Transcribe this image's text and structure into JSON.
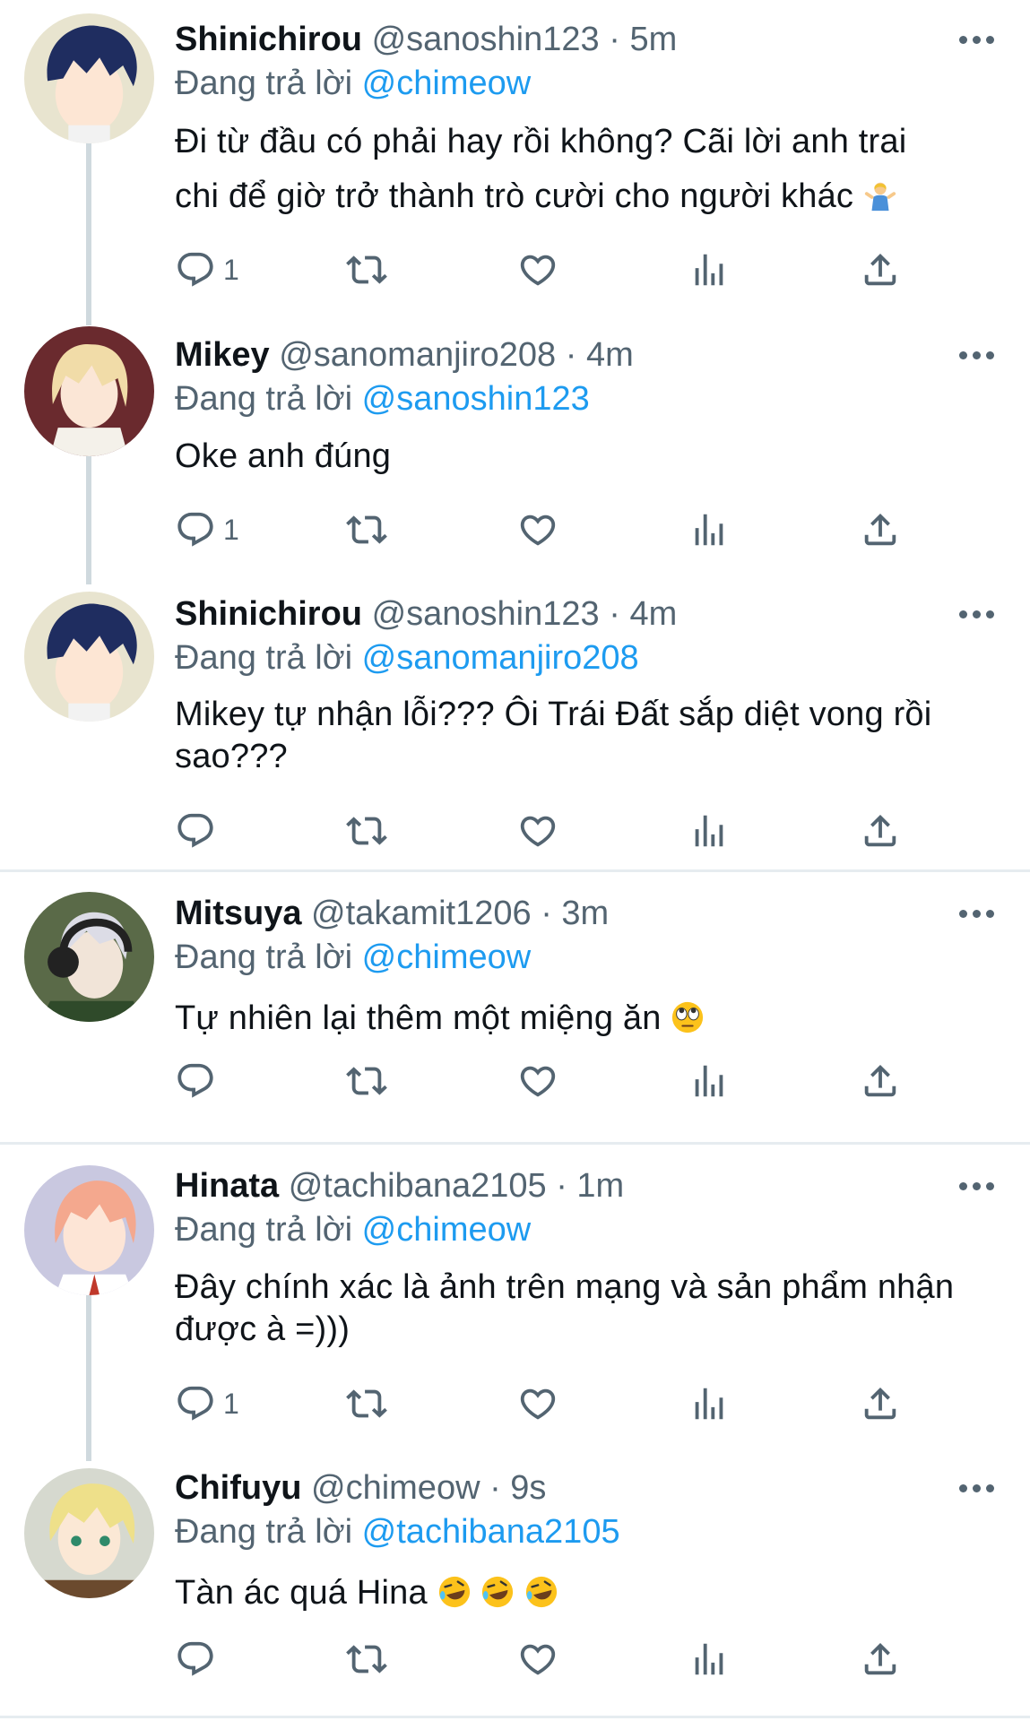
{
  "reply_prefix": "Đang trả lời",
  "colors": {
    "accent": "#1d9bf0",
    "text": "#0f1419",
    "muted": "#536471",
    "thread_line": "#cfd9de",
    "divider": "#e6ecf0"
  },
  "icons": [
    "reply-icon",
    "retweet-icon",
    "like-icon",
    "views-icon",
    "share-icon",
    "more-icon"
  ],
  "tweets": [
    {
      "name": "Shinichirou",
      "handle": "@sanoshin123",
      "dot": "·",
      "time": "5m",
      "reply_to": "@chimeow",
      "text_line1": "Đi từ đầu có phải hay rồi không? Cãi lời anh trai",
      "text_line2": "chi để giờ trở thành trò cười cho người khác",
      "emoji": "person-shrugging",
      "reply_count": "1"
    },
    {
      "name": "Mikey",
      "handle": "@sanomanjiro208",
      "dot": "·",
      "time": "4m",
      "reply_to": "@sanoshin123",
      "text_line1": "Oke anh đúng",
      "reply_count": "1"
    },
    {
      "name": "Shinichirou",
      "handle": "@sanoshin123",
      "dot": "·",
      "time": "4m",
      "reply_to": "@sanomanjiro208",
      "text_line1": "Mikey tự nhận lỗi??? Ôi Trái Đất sắp diệt vong rồi",
      "text_line2": "sao???",
      "reply_count": ""
    },
    {
      "name": "Mitsuya",
      "handle": "@takamit1206",
      "dot": "·",
      "time": "3m",
      "reply_to": "@chimeow",
      "text_line1": "Tự nhiên lại thêm một miệng ăn",
      "emoji": "face-with-rolling-eyes",
      "reply_count": ""
    },
    {
      "name": "Hinata",
      "handle": "@tachibana2105",
      "dot": "·",
      "time": "1m",
      "reply_to": "@chimeow",
      "text_line1": "Đây chính xác là ảnh trên mạng và sản phẩm nhận",
      "text_line2": "được à =)))",
      "reply_count": "1"
    },
    {
      "name": "Chifuyu",
      "handle": "@chimeow",
      "dot": "·",
      "time": "9s",
      "reply_to": "@tachibana2105",
      "text_line1": "Tàn ác quá Hina",
      "emoji": "rolling-on-the-floor-laughing x3",
      "reply_count": ""
    }
  ]
}
